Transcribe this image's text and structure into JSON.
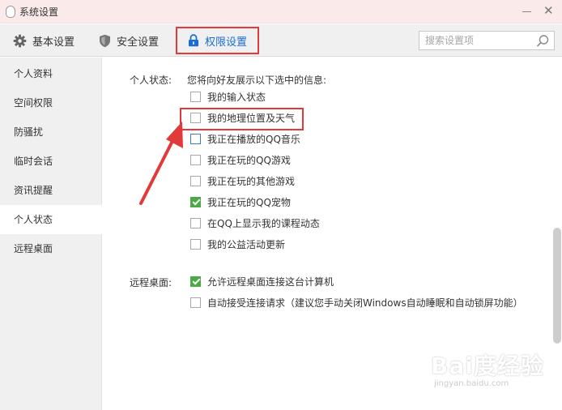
{
  "window": {
    "title": "系统设置",
    "close_glyph": "✕"
  },
  "toolbar": {
    "tabs": [
      {
        "label": "基本设置",
        "icon": "gear-icon"
      },
      {
        "label": "安全设置",
        "icon": "shield-icon"
      },
      {
        "label": "权限设置",
        "icon": "lock-icon",
        "active": true
      }
    ],
    "search_placeholder": "搜索设置项",
    "accent_color": "#1a6ed4"
  },
  "sidebar": {
    "items": [
      {
        "label": "个人资料"
      },
      {
        "label": "空间权限"
      },
      {
        "label": "防骚扰"
      },
      {
        "label": "临时会话"
      },
      {
        "label": "资讯提醒"
      },
      {
        "label": "个人状态",
        "active": true
      },
      {
        "label": "远程桌面"
      }
    ]
  },
  "status_section": {
    "label": "个人状态:",
    "intro": "您将向好友展示以下选中的信息:",
    "options": [
      {
        "label": "我的输入状态",
        "checked": false
      },
      {
        "label": "我的地理位置及天气",
        "checked": false
      },
      {
        "label": "我正在播放的QQ音乐",
        "checked": false
      },
      {
        "label": "我正在玩的QQ游戏",
        "checked": false
      },
      {
        "label": "我正在玩的其他游戏",
        "checked": false
      },
      {
        "label": "我正在玩的QQ宠物",
        "checked": true
      },
      {
        "label": "在QQ上显示我的课程动态",
        "checked": false
      },
      {
        "label": "我的公益活动更新",
        "checked": false
      }
    ]
  },
  "remote_section": {
    "label": "远程桌面:",
    "options": [
      {
        "label": "允许远程桌面连接这台计算机",
        "checked": true
      },
      {
        "label": "自动接受连接请求（建议您手动关闭Windows自动睡眠和自动锁屏功能）",
        "checked": false
      }
    ]
  },
  "colors": {
    "check_green": "#4caa45",
    "annotation_red": "#e23a3a"
  },
  "watermark": {
    "main": "Bai度经验",
    "sub": "jingyan.baidu.com"
  }
}
